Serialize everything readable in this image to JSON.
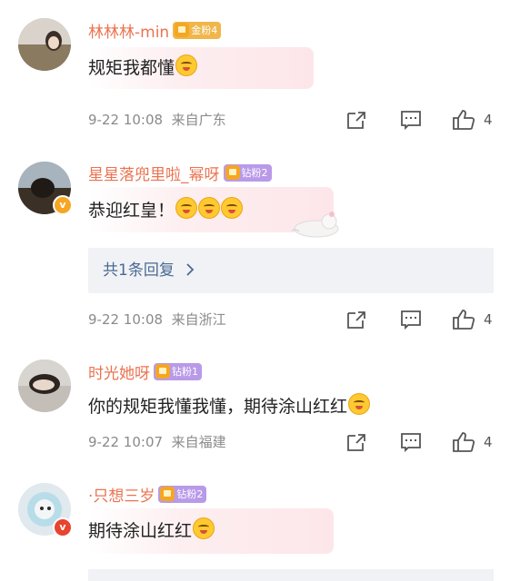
{
  "comments": [
    {
      "username": "林林林-min",
      "badge": "金粉4",
      "text": "规矩我都懂",
      "time": "9-22 10:08",
      "location": "来自广东",
      "likes": "4",
      "emoji_count": 1
    },
    {
      "username": "星星落兜里啦_幂呀",
      "badge": "钻粉2",
      "text": "恭迎红皇！",
      "time": "9-22 10:08",
      "location": "来自浙江",
      "likes": "4",
      "reply_link": "共1条回复",
      "verified": "v"
    },
    {
      "username": "时光她呀",
      "badge": "钻粉1",
      "text": "你的规矩我懂我懂，期待涂山红红",
      "time": "9-22 10:07",
      "location": "来自福建",
      "likes": "4"
    },
    {
      "username": "·只想三岁",
      "badge": "钻粉2",
      "text": "期待涂山红红",
      "verified": "v"
    }
  ],
  "icons": {
    "repost": "share-icon",
    "comment": "comment-icon",
    "like": "thumbs-up-icon",
    "chevron": "chevron-right-icon"
  },
  "colors": {
    "username": "#eb7350",
    "gold_badge": "#f0b64a",
    "diamond_badge": "#b99ae8",
    "reply_link": "#4a6a94",
    "meta": "#8a8a8a"
  }
}
